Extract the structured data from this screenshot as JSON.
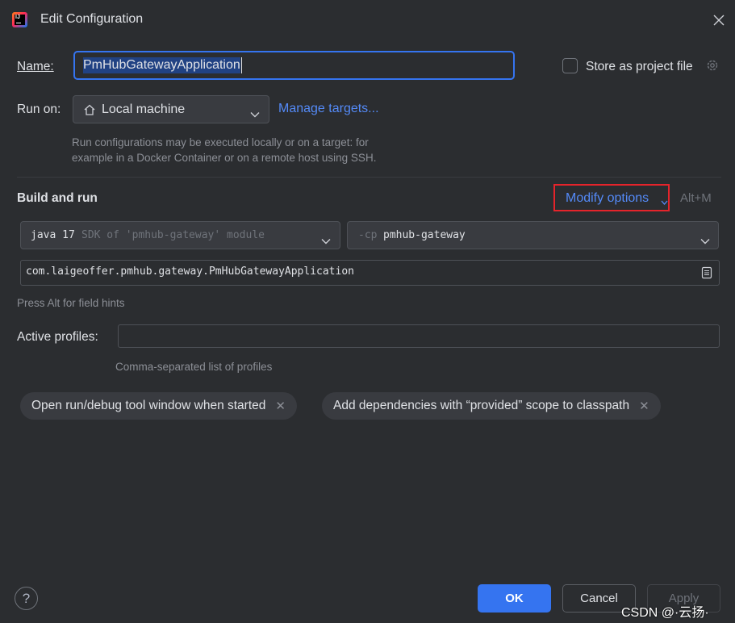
{
  "window": {
    "title": "Edit Configuration",
    "icon": "intellij-idea-icon"
  },
  "name": {
    "label": "Name:",
    "value": "PmHubGatewayApplication"
  },
  "store_as_project_file": {
    "label": "Store as project file",
    "checked": false,
    "icon": "gear-icon"
  },
  "run_on": {
    "label": "Run on:",
    "selected": "Local machine",
    "icon": "house-icon",
    "manage_link": "Manage targets...",
    "hint_line1": "Run configurations may be executed locally or on a target: for",
    "hint_line2": "example in a Docker Container or on a remote host using SSH."
  },
  "build_and_run": {
    "heading": "Build and run",
    "modify_options": "Modify options",
    "shortcut": "Alt+M",
    "sdk": {
      "name": "java 17",
      "detail": "SDK of 'pmhub-gateway' module"
    },
    "classpath": {
      "flag": "-cp",
      "module": "pmhub-gateway"
    },
    "main_class": "com.laigeoffer.pmhub.gateway.PmHubGatewayApplication",
    "field_hint": "Press Alt for field hints"
  },
  "active_profiles": {
    "label": "Active profiles:",
    "value": "",
    "hint": "Comma-separated list of profiles"
  },
  "chips": [
    {
      "label": "Open run/debug tool window when started"
    },
    {
      "label": "Add dependencies with “provided” scope to classpath"
    }
  ],
  "footer": {
    "help": "?",
    "ok": "OK",
    "cancel": "Cancel",
    "apply": "Apply"
  },
  "watermark": "CSDN @·云扬·",
  "colors": {
    "background": "#2b2d30",
    "accent": "#3574f0",
    "link": "#548af7",
    "highlight_box": "#e5242b"
  }
}
